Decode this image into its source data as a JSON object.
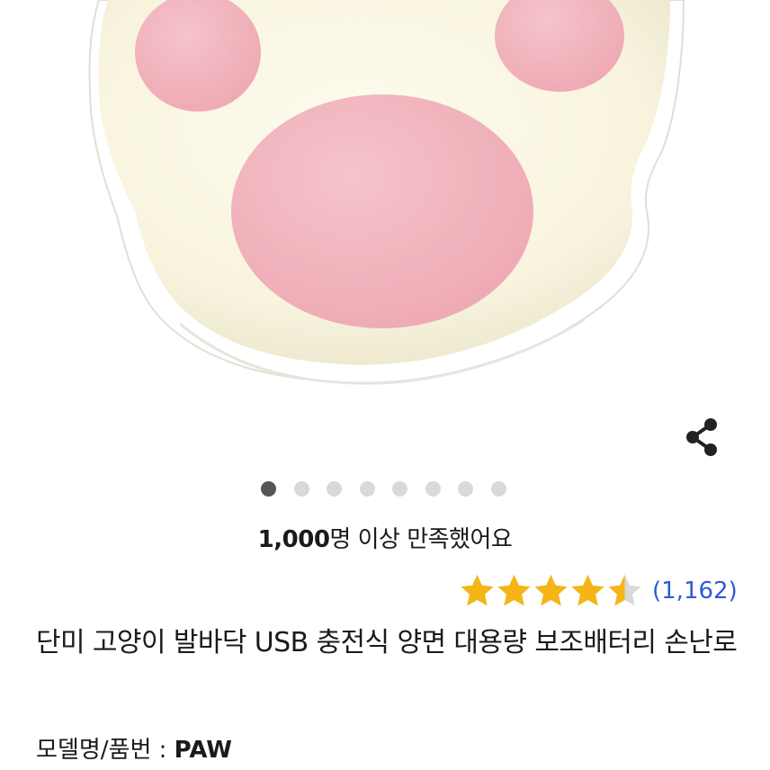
{
  "product_image": {
    "subject": "cat paw hand warmer",
    "colors": {
      "body": "#f8f4de",
      "pads": "#f0b5be",
      "rim": "#ffffff",
      "shadow": "#e4e1da"
    }
  },
  "share": {
    "icon": "share-icon"
  },
  "carousel": {
    "total": 8,
    "active_index": 0,
    "active_color": "#555555",
    "inactive_color": "#d9d9d9"
  },
  "satisfaction": {
    "count": "1,000",
    "text": "명 이상 만족했어요"
  },
  "rating": {
    "stars": 4.5,
    "max": 5,
    "star_color": "#f5b516",
    "empty_color": "#d9d9d9",
    "review_count": "(1,162)"
  },
  "product": {
    "title": "단미 고양이 발바닥 USB 충전식 양면 대용량 보조배터리 손난로",
    "model_label": "모델명/품번 : ",
    "model_value": "PAW"
  }
}
